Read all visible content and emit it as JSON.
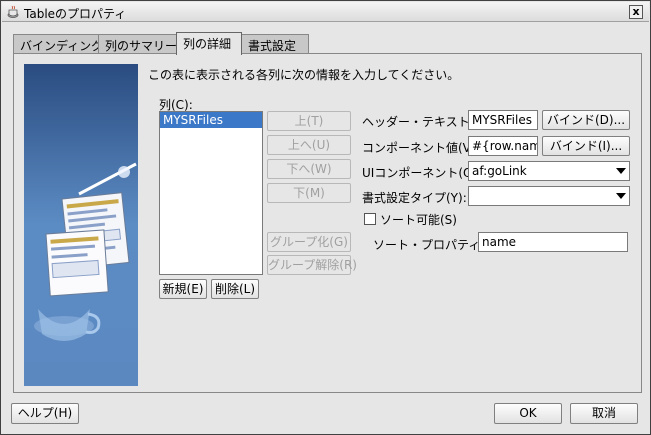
{
  "window": {
    "title": "Tableのプロパティ",
    "close_label": "x"
  },
  "tabs": [
    {
      "label": "バインディング"
    },
    {
      "label": "列のサマリー"
    },
    {
      "label": "列の詳細"
    },
    {
      "label": "書式設定"
    }
  ],
  "instruction": "この表に表示される各列に次の情報を入力してください。",
  "columns": {
    "label": "列(C):",
    "items": [
      "MYSRFiles"
    ],
    "buttons": {
      "up": "上(T)",
      "top": "上へ(U)",
      "down": "下へ(W)",
      "bottom": "下(M)",
      "group": "グループ化(G)",
      "ungroup": "グループ解除(R)",
      "new": "新規(E)",
      "delete": "削除(L)"
    }
  },
  "form": {
    "header_text": {
      "label": "ヘッダー・テキスト(A):",
      "value": "MYSRFiles",
      "bind": "バインド(D)..."
    },
    "component_value": {
      "label": "コンポーネント値(V):",
      "value": "#{row.name}",
      "bind": "バインド(I)..."
    },
    "ui_component": {
      "label": "UIコンポーネント(O):",
      "value": "af:goLink"
    },
    "format_type": {
      "label": "書式設定タイプ(Y):",
      "value": ""
    },
    "sortable": {
      "label": "ソート可能(S)",
      "checked": false
    },
    "sort_property": {
      "label": "ソート・プロパティ(P):",
      "value": "name"
    }
  },
  "footer": {
    "help": "ヘルプ(H)",
    "ok": "OK",
    "cancel": "取消"
  }
}
